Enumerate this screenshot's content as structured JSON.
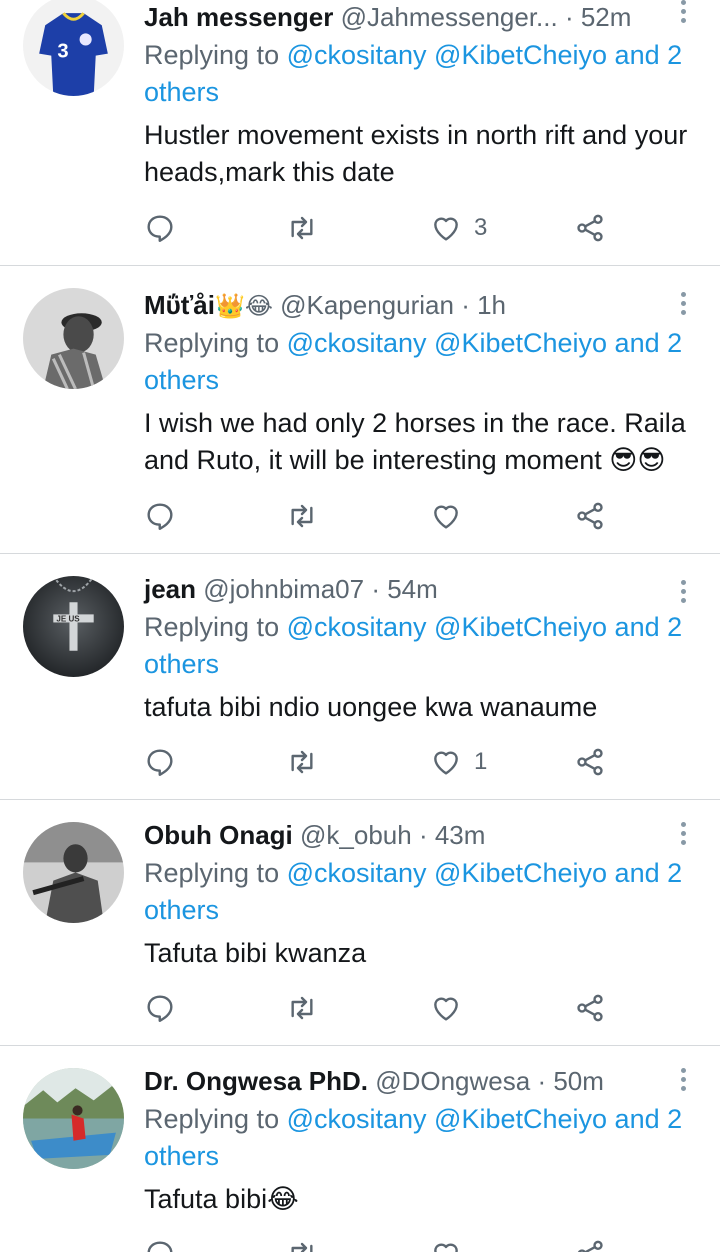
{
  "colors": {
    "accent": "#1b95e0",
    "secondary": "#5b6670",
    "divider": "#d6d9dc"
  },
  "icons": [
    "reply-icon",
    "retweet-icon",
    "like-icon",
    "share-icon",
    "more-options-icon"
  ],
  "tweets": [
    {
      "name": "Jah messenger",
      "emoji": "",
      "handle": "@Jahmessenger...",
      "time": "· 52m",
      "replying_prefix": "Replying to ",
      "replying_mentions": "@ckositany @KibetCheiyo and 2 others",
      "text": "Hustler movement exists in north rift and your heads,mark this date",
      "likes": "3"
    },
    {
      "name": "Mΰťåi",
      "emoji": "👑😂",
      "handle": "@Kapengurian",
      "time": "· 1h",
      "replying_prefix": "Replying to ",
      "replying_mentions": "@ckositany @KibetCheiyo and 2 others",
      "text": "I wish we had only 2 horses in the race. Raila and Ruto, it will be interesting moment 😎😎",
      "likes": ""
    },
    {
      "name": "jean",
      "emoji": "",
      "handle": "@johnbima07",
      "time": "· 54m",
      "replying_prefix": "Replying to ",
      "replying_mentions": "@ckositany @KibetCheiyo and 2 others",
      "text": "tafuta bibi ndio uongee kwa wanaume",
      "likes": "1"
    },
    {
      "name": "Obuh Onagi",
      "emoji": "",
      "handle": "@k_obuh",
      "time": "· 43m",
      "replying_prefix": "Replying to ",
      "replying_mentions": "@ckositany @KibetCheiyo and 2 others",
      "text": "Tafuta bibi kwanza",
      "likes": ""
    },
    {
      "name": "Dr. Ongwesa PhD.",
      "emoji": "",
      "handle": "@DOngwesa",
      "time": "· 50m",
      "replying_prefix": "Replying to ",
      "replying_mentions": "@ckositany @KibetCheiyo and 2 others",
      "text": "Tafuta bibi😂",
      "likes": ""
    }
  ]
}
